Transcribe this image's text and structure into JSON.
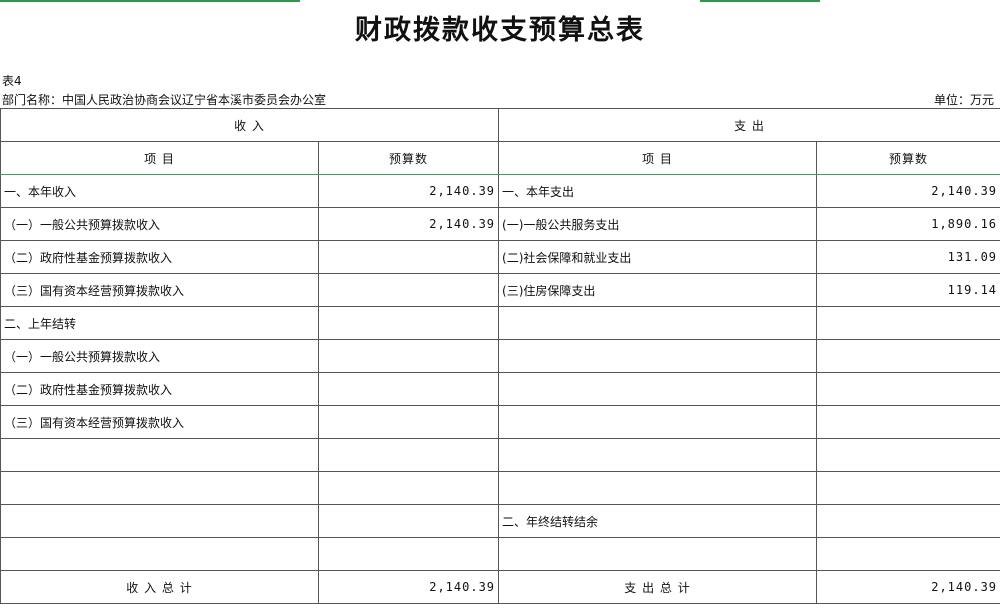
{
  "title": "财政拨款收支预算总表",
  "table_no": "表4",
  "dept": "部门名称：中国人民政治协商会议辽宁省本溪市委员会办公室",
  "unit": "单位：万元",
  "header": {
    "income": "收    入",
    "expense": "支    出",
    "item": "项    目",
    "budget": "预算数"
  },
  "rows": [
    {
      "left_label": "一、本年收入",
      "left_value": "2,140.39",
      "right_label": "一、本年支出",
      "right_value": "2,140.39"
    },
    {
      "left_label": "（一）一般公共预算拨款收入",
      "left_value": "2,140.39",
      "right_label": "(一)一般公共服务支出",
      "right_value": "1,890.16"
    },
    {
      "left_label": "（二）政府性基金预算拨款收入",
      "left_value": "",
      "right_label": "(二)社会保障和就业支出",
      "right_value": "131.09"
    },
    {
      "left_label": "（三）国有资本经营预算拨款收入",
      "left_value": "",
      "right_label": "(三)住房保障支出",
      "right_value": "119.14"
    },
    {
      "left_label": "二、上年结转",
      "left_value": "",
      "right_label": "",
      "right_value": ""
    },
    {
      "left_label": "（一）一般公共预算拨款收入",
      "left_value": "",
      "right_label": "",
      "right_value": ""
    },
    {
      "left_label": "（二）政府性基金预算拨款收入",
      "left_value": "",
      "right_label": "",
      "right_value": ""
    },
    {
      "left_label": "（三）国有资本经营预算拨款收入",
      "left_value": "",
      "right_label": "",
      "right_value": ""
    },
    {
      "left_label": "",
      "left_value": "",
      "right_label": "",
      "right_value": ""
    },
    {
      "left_label": "",
      "left_value": "",
      "right_label": "",
      "right_value": ""
    },
    {
      "left_label": "",
      "left_value": "",
      "right_label": "二、年终结转结余",
      "right_value": ""
    },
    {
      "left_label": "",
      "left_value": "",
      "right_label": "",
      "right_value": ""
    }
  ],
  "totals": {
    "income_label": "收    入    总    计",
    "income_value": "2,140.39",
    "expense_label": "支    出    总    计",
    "expense_value": "2,140.39"
  },
  "accent_color": "#2e9a48"
}
